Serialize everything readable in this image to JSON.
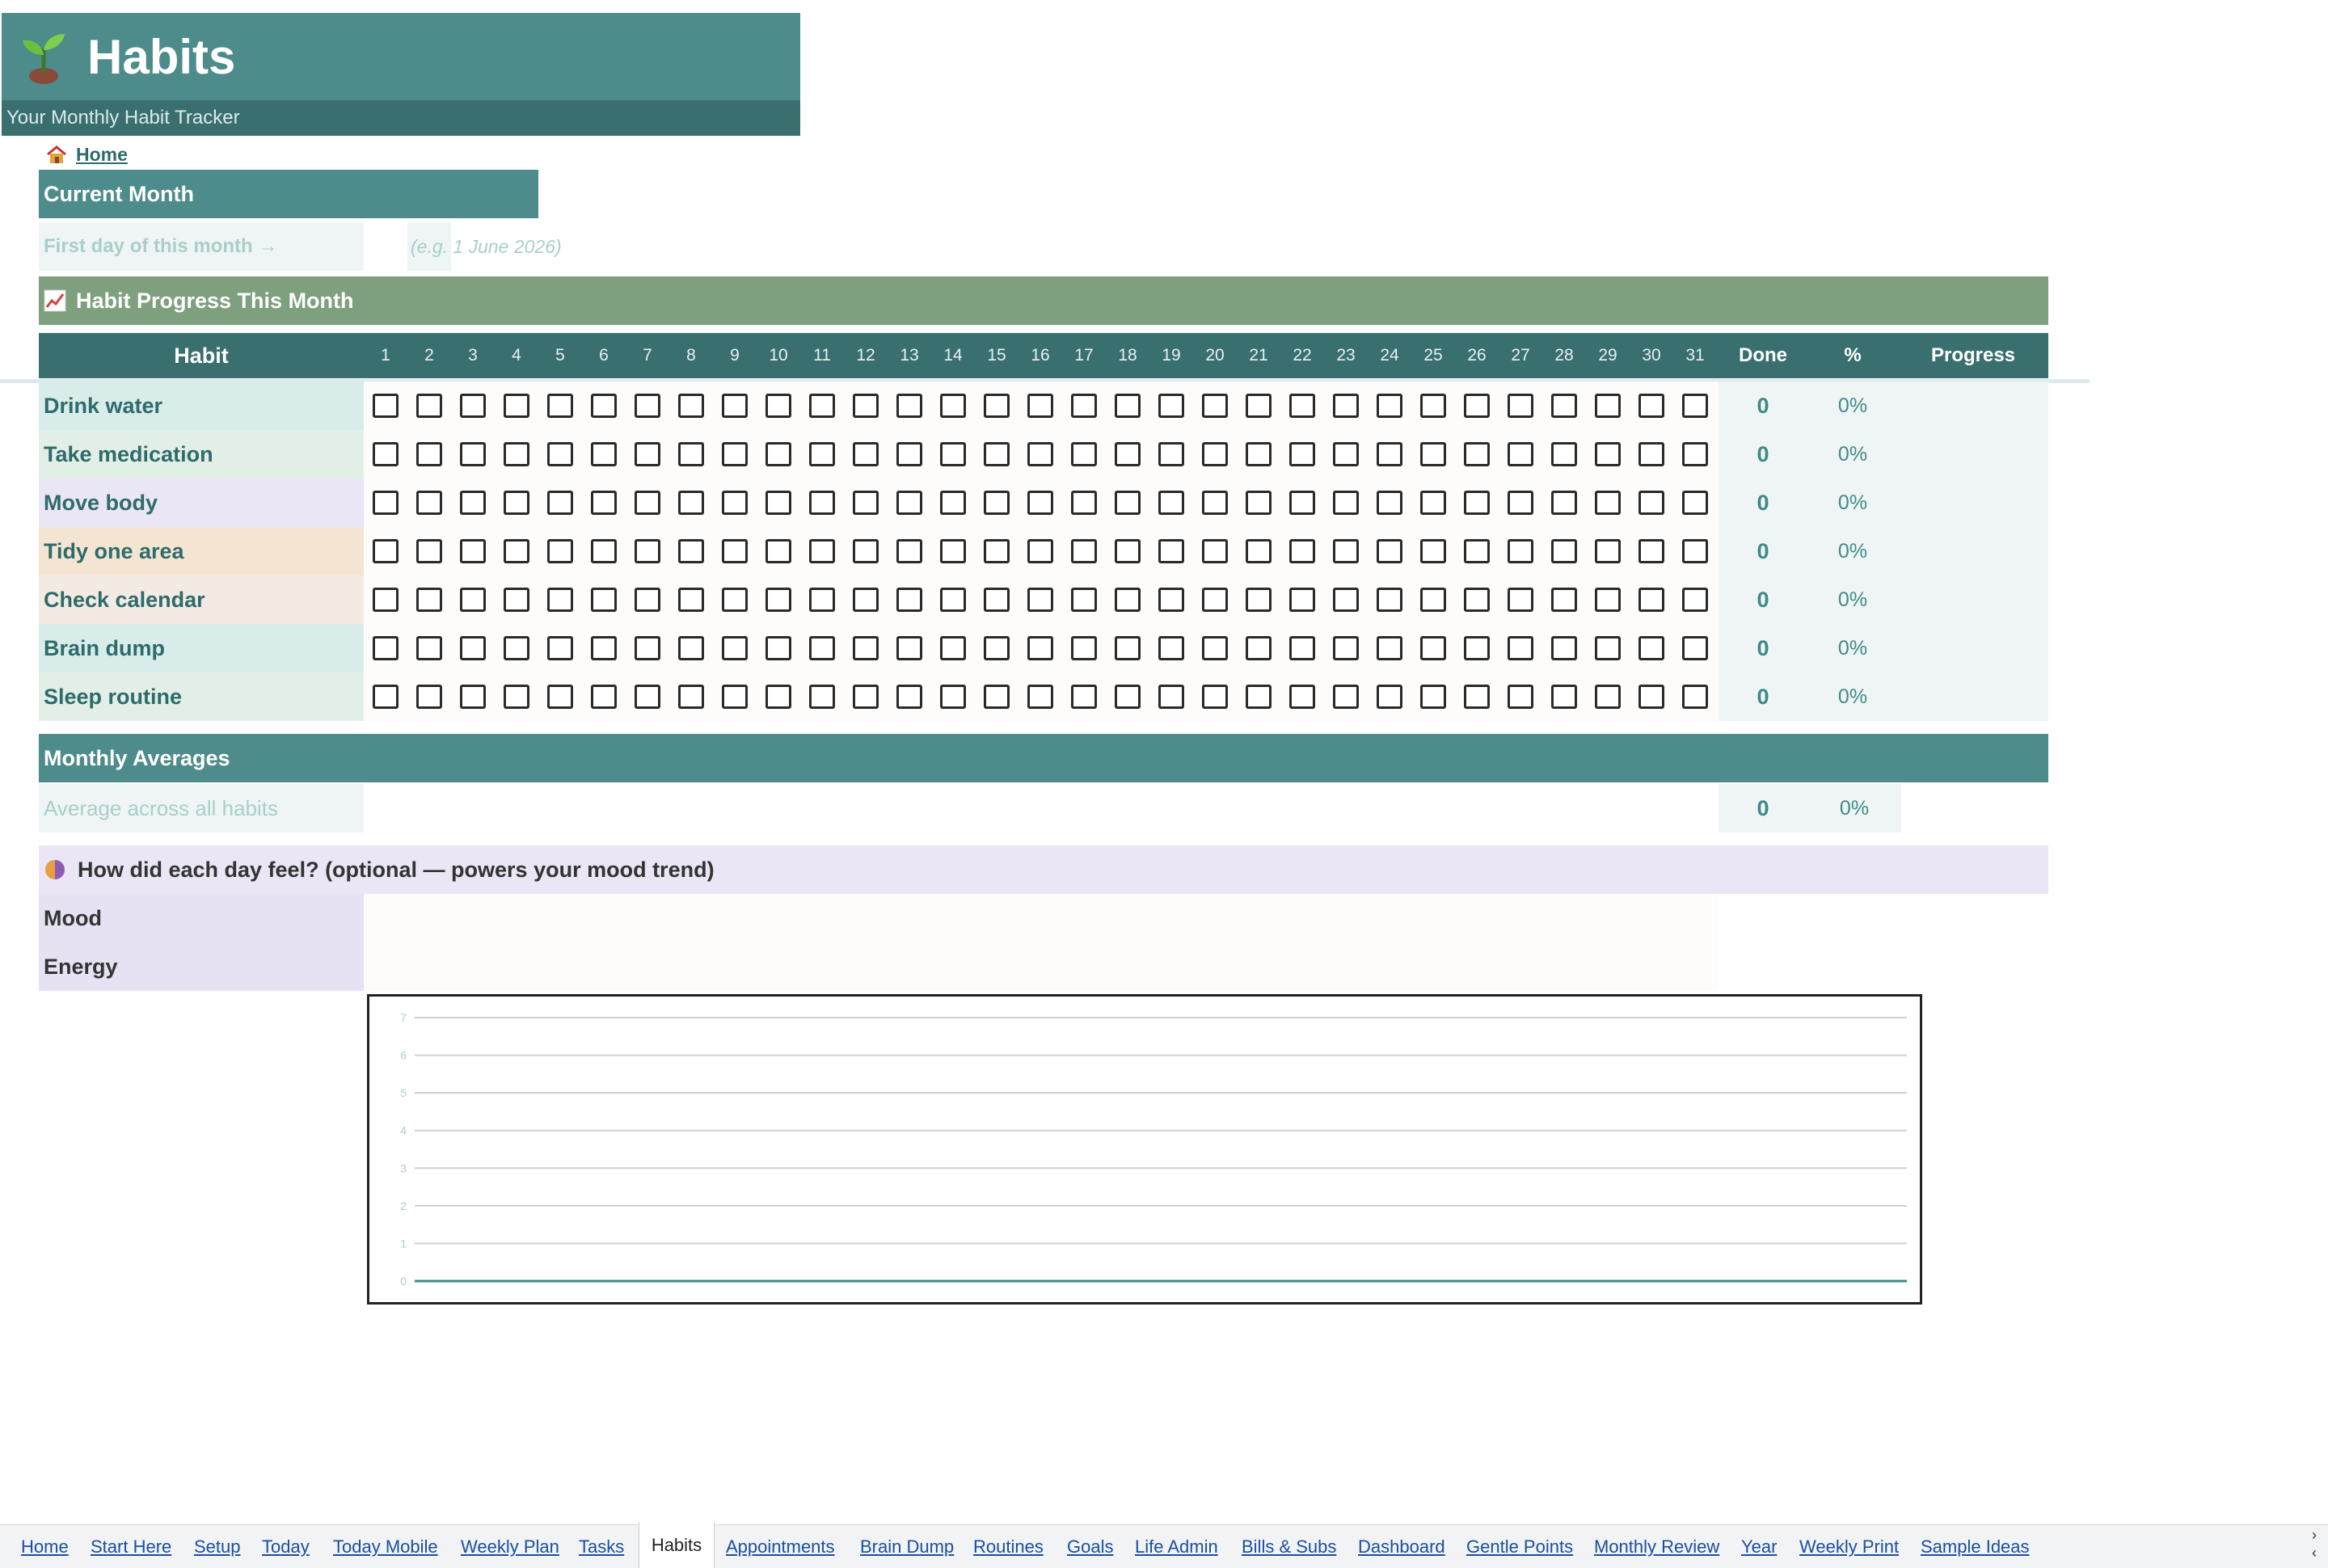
{
  "header": {
    "title": "Habits",
    "subtitle": "Your Monthly Habit Tracker",
    "icon": "sprout-icon"
  },
  "nav": {
    "home_label": "Home",
    "home_icon": "house-icon"
  },
  "current_month": {
    "section_title": "Current Month",
    "first_day_label": "First day of this month →",
    "first_day_value": "",
    "first_day_hint": "(e.g. 1 June 2026)"
  },
  "progress": {
    "section_title": "Habit Progress This Month",
    "section_icon": "chart-increasing-icon",
    "columns": {
      "habit": "Habit",
      "days": [
        "1",
        "2",
        "3",
        "4",
        "5",
        "6",
        "7",
        "8",
        "9",
        "10",
        "11",
        "12",
        "13",
        "14",
        "15",
        "16",
        "17",
        "18",
        "19",
        "20",
        "21",
        "22",
        "23",
        "24",
        "25",
        "26",
        "27",
        "28",
        "29",
        "30",
        "31"
      ],
      "done": "Done",
      "pct": "%",
      "progress": "Progress"
    },
    "habits": [
      {
        "name": "Drink water",
        "done": "0",
        "pct": "0%",
        "color": "#d8ecea",
        "checked": []
      },
      {
        "name": "Take medication",
        "done": "0",
        "pct": "0%",
        "color": "#e2efe6",
        "checked": []
      },
      {
        "name": "Move body",
        "done": "0",
        "pct": "0%",
        "color": "#ebe6f5",
        "checked": []
      },
      {
        "name": "Tidy one area",
        "done": "0",
        "pct": "0%",
        "color": "#f4e5d2",
        "checked": []
      },
      {
        "name": "Check calendar",
        "done": "0",
        "pct": "0%",
        "color": "#f3ebe3",
        "checked": []
      },
      {
        "name": "Brain dump",
        "done": "0",
        "pct": "0%",
        "color": "#d8ecea",
        "checked": []
      },
      {
        "name": "Sleep routine",
        "done": "0",
        "pct": "0%",
        "color": "#e2efe6",
        "checked": []
      }
    ]
  },
  "averages": {
    "section_title": "Monthly Averages",
    "label": "Average across all habits",
    "done": "0",
    "pct": "0%"
  },
  "mood": {
    "section_title": "How did each day feel? (optional — powers your mood trend)",
    "section_icon": "mood-circle-icon",
    "rows": [
      "Mood",
      "Energy"
    ]
  },
  "chart_data": {
    "type": "line",
    "title": "",
    "xlabel": "",
    "ylabel": "",
    "ylim": [
      0,
      7
    ],
    "yticks": [
      "0",
      "1",
      "2",
      "3",
      "4",
      "5",
      "6",
      "7"
    ],
    "series": [
      {
        "values": [
          0,
          0
        ]
      }
    ],
    "grid": true,
    "colors": {
      "line": "#3f8a88",
      "tick": "#a8cfcc",
      "grid": "#cfcfcf"
    }
  },
  "tabs": {
    "active": "Habits",
    "items": [
      "Home",
      "Start Here",
      "Setup",
      "Today",
      "Today Mobile",
      "Weekly Plan",
      "Tasks",
      "Habits",
      "Appointments",
      "Brain Dump",
      "Routines",
      "Goals",
      "Life Admin",
      "Bills & Subs",
      "Dashboard",
      "Gentle Points",
      "Monthly Review",
      "Year",
      "Weekly Print",
      "Sample Ideas"
    ]
  },
  "theme": {
    "teal": "#4d8c8a",
    "teal_dark": "#39706f",
    "sage": "#7ea07e",
    "lavender": "#eae6f5"
  }
}
